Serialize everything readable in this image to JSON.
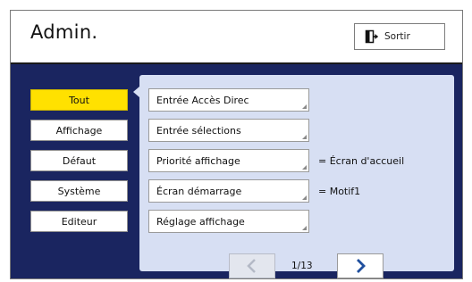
{
  "header": {
    "title": "Admin.",
    "exit_label": "Sortir"
  },
  "sidebar": {
    "items": [
      {
        "label": "Tout",
        "active": true
      },
      {
        "label": "Affichage",
        "active": false
      },
      {
        "label": "Défaut",
        "active": false
      },
      {
        "label": "Système",
        "active": false
      },
      {
        "label": "Editeur",
        "active": false
      }
    ]
  },
  "panel": {
    "items": [
      {
        "label": "Entrée Accès Direc",
        "value": ""
      },
      {
        "label": "Entrée sélections",
        "value": ""
      },
      {
        "label": "Priorité affichage",
        "value": "= Écran d'accueil"
      },
      {
        "label": "Écran démarrage",
        "value": "= Motif1"
      },
      {
        "label": "Réglage affichage",
        "value": ""
      }
    ]
  },
  "pagination": {
    "current": 1,
    "total": 13,
    "text": "1/13",
    "prev_icon": "chevron-left-icon",
    "next_icon": "chevron-right-icon",
    "prev_disabled": true
  },
  "colors": {
    "background_navy": "#1a2560",
    "panel": "#d7dff3",
    "active_tab": "#ffe100",
    "next_arrow": "#1f4f9e"
  }
}
